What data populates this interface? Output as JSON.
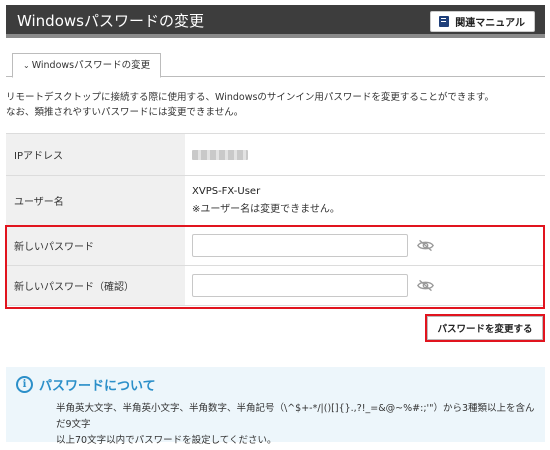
{
  "header": {
    "title": "Windowsパスワードの変更",
    "manual_button": "関連マニュアル"
  },
  "tabs": [
    {
      "label": "Windowsパスワードの変更",
      "chevron": "⌄"
    }
  ],
  "description": {
    "line1": "リモートデスクトップに接続する際に使用する、Windowsのサインイン用パスワードを変更することができます。",
    "line2": "なお、類推されやすいパスワードには変更できません。"
  },
  "form": {
    "ip_label": "IPアドレス",
    "ip_value_obscured": true,
    "user_label": "ユーザー名",
    "user_value": "XVPS-FX-User",
    "user_note": "※ユーザー名は変更できません。",
    "new_password_label": "新しいパスワード",
    "new_password_value": "",
    "confirm_password_label": "新しいパスワード（確認）",
    "confirm_password_value": "",
    "visibility_icon": "eye-off-icon"
  },
  "submit_button": "パスワードを変更する",
  "info": {
    "title": "パスワードについて",
    "line1": "半角英大文字、半角英小文字、半角数字、半角記号（\\^$+-*/|()[]{}.,?!_=&@~%#:;'\"）から3種類以上を含んだ9文字",
    "line2": "以上70文字以内でパスワードを設定してください。"
  },
  "colors": {
    "header_bg": "#3d3d3d",
    "highlight": "#e1141e",
    "info_accent": "#2b8fc9",
    "info_bg": "#edf6fb"
  }
}
